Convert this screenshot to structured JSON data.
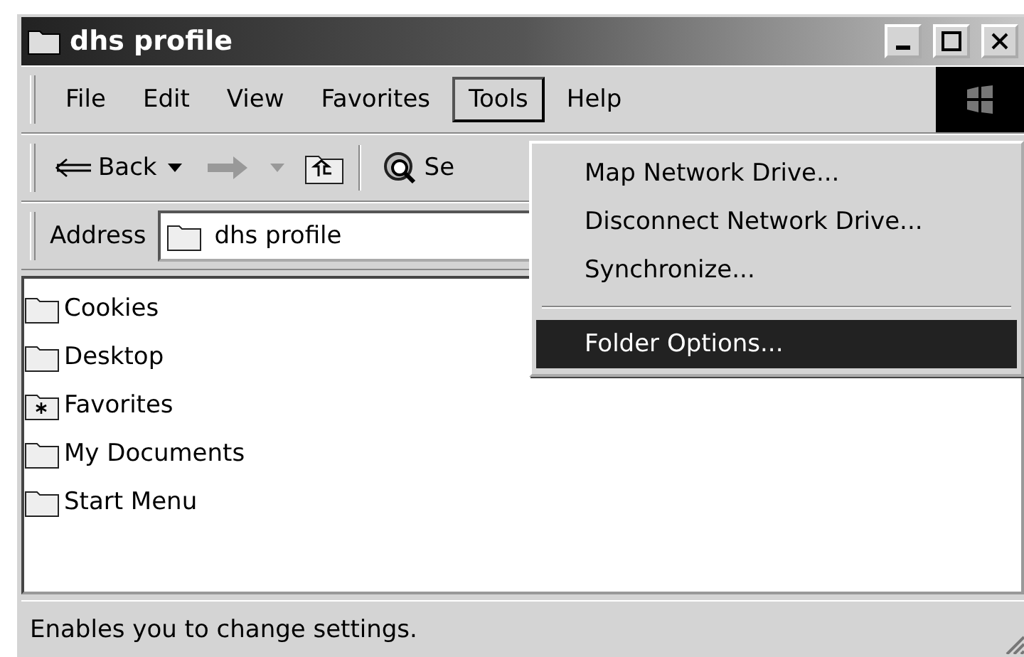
{
  "window": {
    "title": "dhs profile"
  },
  "menu_bar": [
    {
      "label": "File",
      "selected": false
    },
    {
      "label": "Edit",
      "selected": false
    },
    {
      "label": "View",
      "selected": false
    },
    {
      "label": "Favorites",
      "selected": false
    },
    {
      "label": "Tools",
      "selected": true
    },
    {
      "label": "Help",
      "selected": false
    }
  ],
  "toolbar": {
    "back": "Back",
    "search": "Se"
  },
  "address": {
    "label": "Address",
    "value": "dhs profile"
  },
  "tools_menu": [
    {
      "kind": "item",
      "label": "Map Network Drive...",
      "selected": false
    },
    {
      "kind": "item",
      "label": "Disconnect Network Drive...",
      "selected": false
    },
    {
      "kind": "item",
      "label": "Synchronize...",
      "selected": false
    },
    {
      "kind": "separator"
    },
    {
      "kind": "item",
      "label": "Folder Options...",
      "selected": true
    }
  ],
  "files": [
    {
      "name": "Cookies",
      "kind": "folder"
    },
    {
      "name": "Desktop",
      "kind": "folder"
    },
    {
      "name": "Favorites",
      "kind": "favorites"
    },
    {
      "name": "My Documents",
      "kind": "folder"
    },
    {
      "name": "Start Menu",
      "kind": "folder"
    }
  ],
  "status_bar": "Enables you to change settings."
}
